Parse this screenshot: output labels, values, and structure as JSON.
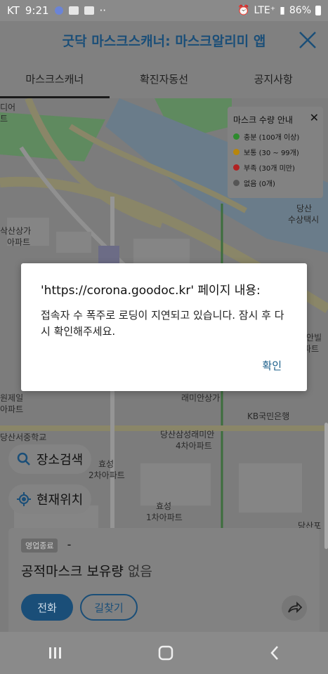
{
  "status_bar": {
    "carrier": "KT",
    "time": "9:21",
    "signal": "LTE⁺",
    "battery": "86%"
  },
  "header": {
    "title": "굿닥 마스크스캐너: 마스크알리미 앱",
    "close_icon": "close-icon"
  },
  "tabs": [
    {
      "label": "마스크스캐너",
      "active": true
    },
    {
      "label": "확진자동선",
      "active": false
    },
    {
      "label": "공지사항",
      "active": false
    }
  ],
  "legend": {
    "title": "마스크 수량 안내",
    "items": [
      {
        "label": "충분 (100개 이상)",
        "color": "#2e8b2e"
      },
      {
        "label": "보통 (30 ~ 99개)",
        "color": "#b8860b"
      },
      {
        "label": "부족 (30개 미만)",
        "color": "#b22222"
      },
      {
        "label": "없음 (0개)",
        "color": "#555555"
      }
    ]
  },
  "map_labels": {
    "label_1": "디어",
    "label_2": "트",
    "label_3": "당산",
    "label_4": "수상택시",
    "label_5": "삭산상가",
    "label_6": "아파트",
    "label_7": "미안빌딩",
    "label_8": "파트",
    "label_9": "원제일",
    "label_10": "아파트",
    "label_11": "당산서중학교",
    "label_12": "래미안상가",
    "label_13": "KB국민은행",
    "label_14": "당산삼성래미안",
    "label_15": "4차아파트",
    "label_16": "효성",
    "label_17": "2차아파트",
    "label_18": "효성",
    "label_19": "1차아파트",
    "label_20": "당산포"
  },
  "buttons": {
    "place_search": "장소검색",
    "current_location": "현재위치"
  },
  "card": {
    "badge": "영업종료",
    "dash": "-",
    "stock_label": "공적마스크 보유량",
    "stock_status": "없음",
    "call": "전화",
    "directions": "길찾기"
  },
  "dialog": {
    "title": "'https://corona.goodoc.kr' 페이지 내용:",
    "message": "접속자 수 폭주로 로딩이 지연되고 있습니다. 잠시 후 다시 확인해주세요.",
    "ok": "확인"
  }
}
